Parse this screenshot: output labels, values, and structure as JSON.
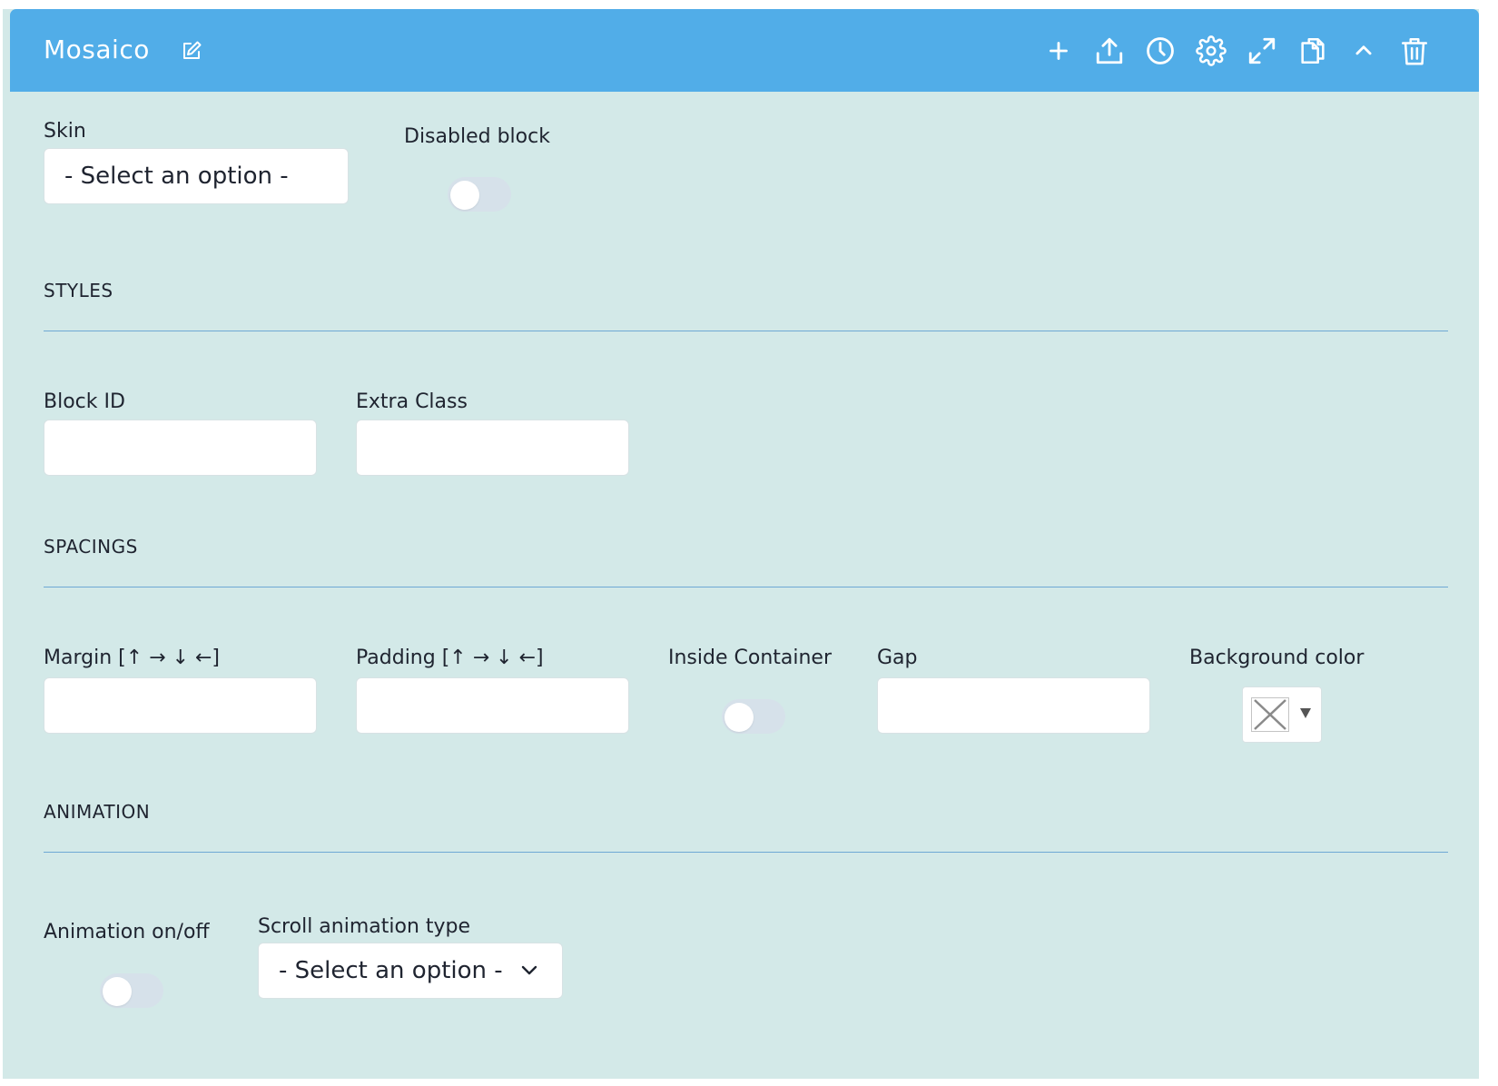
{
  "header": {
    "title": "Mosaico",
    "background_color": "#51ade8",
    "tools": [
      {
        "icon": "plus-icon",
        "name": "add-button"
      },
      {
        "icon": "upload-icon",
        "name": "upload-button"
      },
      {
        "icon": "clock-icon",
        "name": "history-button"
      },
      {
        "icon": "gear-icon",
        "name": "settings-button"
      },
      {
        "icon": "expand-icon",
        "name": "expand-button"
      },
      {
        "icon": "copy-icon",
        "name": "duplicate-button"
      },
      {
        "icon": "chevron-up-icon",
        "name": "collapse-button"
      },
      {
        "icon": "trash-icon",
        "name": "delete-button"
      }
    ]
  },
  "general": {
    "skin_label": "Skin",
    "skin_value": "- Select an option -",
    "disabled_label": "Disabled block",
    "disabled_on": false
  },
  "styles": {
    "title": "STYLES",
    "block_id_label": "Block ID",
    "block_id_value": "",
    "extra_class_label": "Extra Class",
    "extra_class_value": ""
  },
  "spacings": {
    "title": "SPACINGS",
    "margin_label": "Margin [↑ → ↓ ←]",
    "margin_value": "",
    "padding_label": "Padding [↑ → ↓ ←]",
    "padding_value": "",
    "inside_label": "Inside Container",
    "inside_on": false,
    "gap_label": "Gap",
    "gap_value": "",
    "bg_label": "Background color",
    "bg_value": "none"
  },
  "animation": {
    "title": "ANIMATION",
    "onoff_label": "Animation on/off",
    "onoff_on": false,
    "type_label": "Scroll animation type",
    "type_value": "- Select an option -"
  },
  "colors": {
    "panel_bg": "#d3e9e8",
    "rule": "#6ea8d4",
    "toggle_off": "#d6e1ea"
  }
}
